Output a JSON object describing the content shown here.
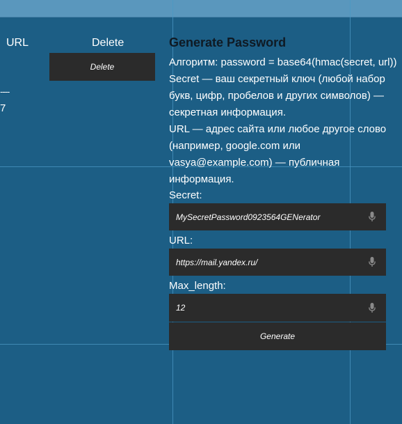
{
  "colors": {
    "background": "#1c5e85",
    "topbar": "#5a97bd",
    "dark": "#2b2b2b",
    "guide": "#4b98c4",
    "title": "#0f1a24",
    "mic": "#8a8a8a"
  },
  "table": {
    "headers": {
      "url": "URL",
      "delete": "Delete"
    },
    "delete_button_label": "Delete",
    "separator_text": "----",
    "row_value": "7"
  },
  "generator": {
    "title": "Generate Password",
    "description_lines": [
      "Алгоритм: password = base64(hmac(secret, url))",
      "Secret — ваш секретный ключ (любой набор",
      "букв, цифр, пробелов и других символов) —",
      "секретная информация.",
      "URL — адрес сайта или любое другое слово",
      "(например, google.com или",
      "vasya@example.com) — публичная",
      "информация."
    ],
    "secret_label": "Secret:",
    "secret_value": "MySecretPassword0923564GENerator",
    "url_label": "URL:",
    "url_value": "https://mail.yandex.ru/",
    "maxlen_label": "Max_length:",
    "maxlen_value": "12",
    "generate_label": "Generate",
    "mic_icon": "microphone-icon"
  }
}
